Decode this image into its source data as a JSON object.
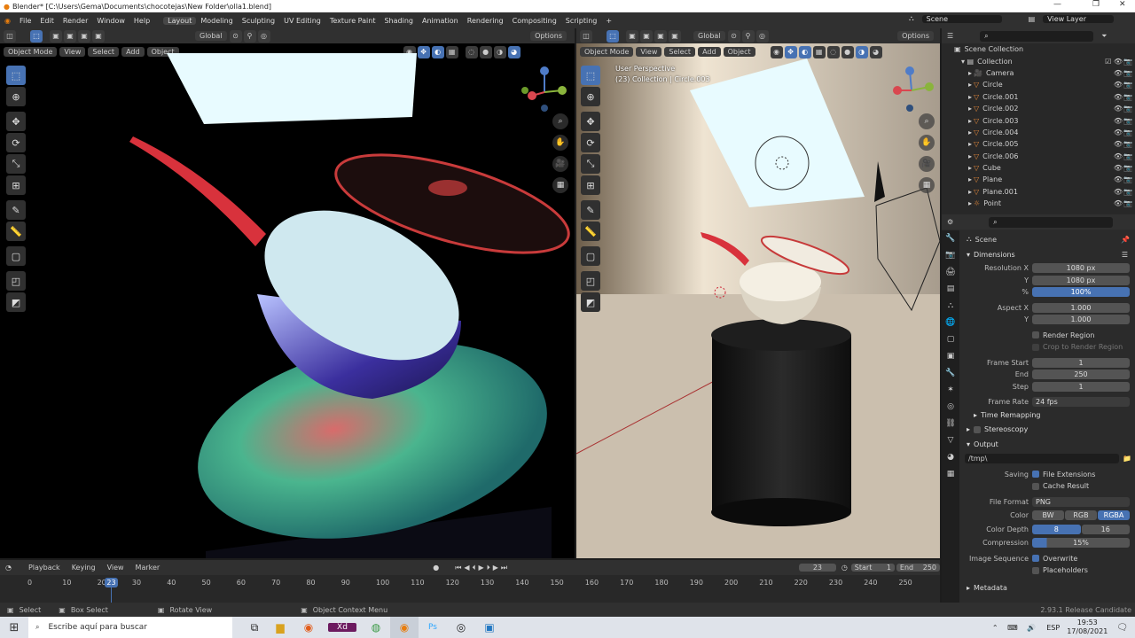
{
  "window": {
    "title": "Blender* [C:\\Users\\Gema\\Documents\\chocotejas\\New Folder\\olla1.blend]"
  },
  "menu": [
    "File",
    "Edit",
    "Render",
    "Window",
    "Help"
  ],
  "workspaces": [
    "Layout",
    "Modeling",
    "Sculpting",
    "UV Editing",
    "Texture Paint",
    "Shading",
    "Animation",
    "Rendering",
    "Compositing",
    "Scripting"
  ],
  "active_workspace": "Layout",
  "scene_name": "Scene",
  "view_layer": "View Layer",
  "left_view": {
    "transform": "Global",
    "mode": "Object Mode",
    "menus": [
      "View",
      "Select",
      "Add",
      "Object"
    ],
    "options": "Options"
  },
  "right_view": {
    "transform": "Global",
    "mode": "Object Mode",
    "menus": [
      "View",
      "Select",
      "Add",
      "Object"
    ],
    "options": "Options",
    "overlay_line1": "User Perspective",
    "overlay_line2": "(23) Collection | Circle.003"
  },
  "outliner": {
    "root": "Scene Collection",
    "collection": "Collection",
    "items": [
      "Camera",
      "Circle",
      "Circle.001",
      "Circle.002",
      "Circle.003",
      "Circle.004",
      "Circle.005",
      "Circle.006",
      "Cube",
      "Plane",
      "Plane.001",
      "Point"
    ]
  },
  "properties": {
    "context": "Scene",
    "dimensions": {
      "title": "Dimensions",
      "res_x_label": "Resolution X",
      "res_x": "1080 px",
      "res_y_label": "Y",
      "res_y": "1080 px",
      "pct_label": "%",
      "pct": "100%",
      "aspect_x_label": "Aspect X",
      "aspect_x": "1.000",
      "aspect_y_label": "Y",
      "aspect_y": "1.000",
      "render_region": "Render Region",
      "crop": "Crop to Render Region",
      "frame_start_label": "Frame Start",
      "frame_start": "1",
      "end_label": "End",
      "end": "250",
      "step_label": "Step",
      "step": "1",
      "frame_rate_label": "Frame Rate",
      "frame_rate": "24 fps",
      "time_remapping": "Time Remapping",
      "stereoscopy": "Stereoscopy"
    },
    "output": {
      "title": "Output",
      "path": "/tmp\\",
      "saving_label": "Saving",
      "file_ext": "File Extensions",
      "cache": "Cache Result",
      "format_label": "File Format",
      "format": "PNG",
      "color_label": "Color",
      "color_opts": [
        "BW",
        "RGB",
        "RGBA"
      ],
      "depth_label": "Color Depth",
      "depth_opts": [
        "8",
        "16"
      ],
      "compression_label": "Compression",
      "compression": "15%",
      "imgseq_label": "Image Sequence",
      "overwrite": "Overwrite",
      "placeholders": "Placeholders"
    },
    "metadata": "Metadata"
  },
  "timeline": {
    "menus": [
      "Playback",
      "Keying",
      "View",
      "Marker"
    ],
    "current": "23",
    "start_label": "Start",
    "start": "1",
    "end_label": "End",
    "end": "250",
    "ticks": [
      "0",
      "10",
      "20",
      "30",
      "40",
      "50",
      "60",
      "70",
      "80",
      "90",
      "100",
      "110",
      "120",
      "130",
      "140",
      "150",
      "160",
      "170",
      "180",
      "190",
      "200",
      "210",
      "220",
      "230",
      "240",
      "250"
    ]
  },
  "status": {
    "select": "Select",
    "box": "Box Select",
    "rotate": "Rotate View",
    "context": "Object Context Menu",
    "version": "2.93.1 Release Candidate"
  },
  "taskbar": {
    "search": "Escribe aquí para buscar",
    "lang": "ESP",
    "time": "19:53",
    "date": "17/08/2021"
  }
}
